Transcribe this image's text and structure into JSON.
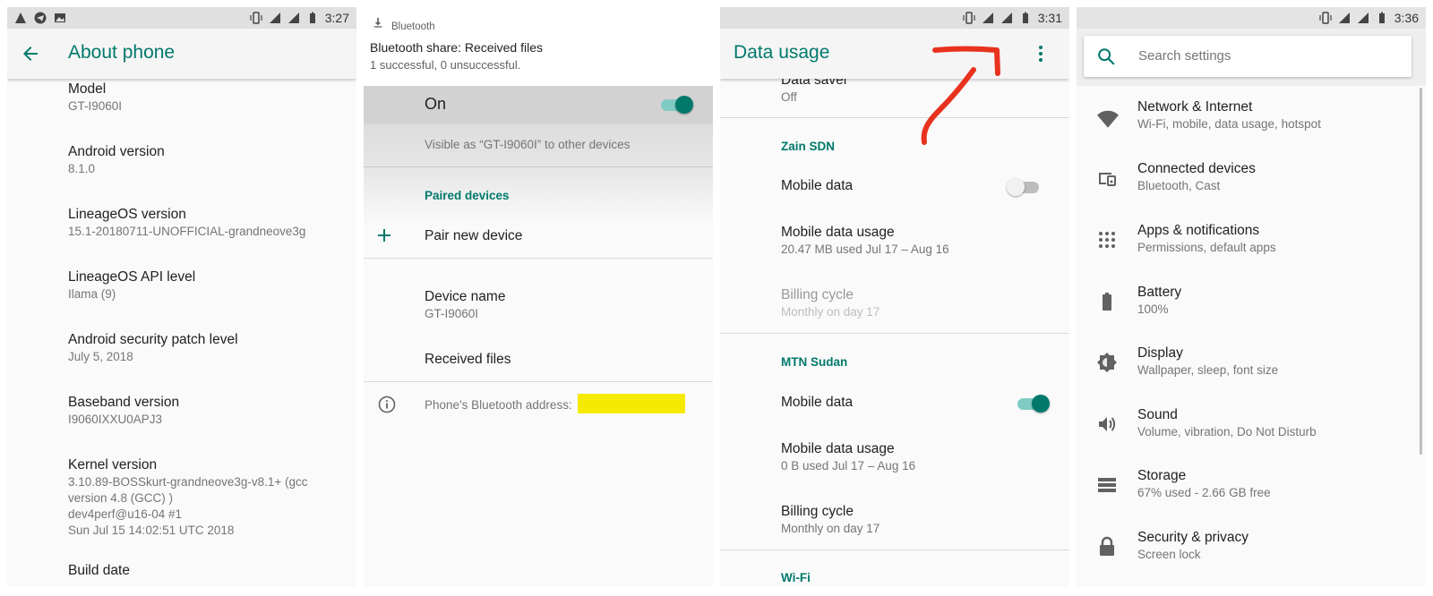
{
  "about_phone": {
    "status_time": "3:27",
    "title": "About phone",
    "items": [
      {
        "label": "Model",
        "value": "GT-I9060I"
      },
      {
        "label": "Android version",
        "value": "8.1.0"
      },
      {
        "label": "LineageOS version",
        "value": "15.1-20180711-UNOFFICIAL-grandneove3g"
      },
      {
        "label": "LineageOS API level",
        "value": "Ilama (9)"
      },
      {
        "label": "Android security patch level",
        "value": "July 5, 2018"
      },
      {
        "label": "Baseband version",
        "value": "I9060IXXU0APJ3"
      },
      {
        "label": "Kernel version",
        "value_lines": [
          "3.10.89-BOSSkurt-grandneove3g-v8.1+ (gcc",
          "version 4.8 (GCC) )",
          "dev4perf@u16-04 #1",
          "Sun Jul 15 14:02:51 UTC 2018"
        ]
      },
      {
        "label": "Build date"
      }
    ]
  },
  "bluetooth": {
    "notification": {
      "app": "Bluetooth",
      "title": "Bluetooth share: Received files",
      "text": "1 successful, 0 unsuccessful."
    },
    "on_label": "On",
    "visible_text": "Visible as “GT-I9060I” to other devices",
    "paired_header": "Paired devices",
    "pair_new": "Pair new device",
    "device_name_label": "Device name",
    "device_name_value": "GT-I9060I",
    "received_files": "Received files",
    "address_label": "Phone's Bluetooth address:",
    "highlight_color": "#f5ea00"
  },
  "data_usage": {
    "status_time": "3:31",
    "title": "Data usage",
    "data_saver_label": "Data saver",
    "data_saver_value": "Off",
    "sim1": {
      "name": "Zain SDN",
      "mobile_data": "Mobile data",
      "usage_label": "Mobile data usage",
      "usage_value": "20.47 MB used Jul 17 – Aug 16",
      "billing_label": "Billing cycle",
      "billing_value": "Monthly on day 17"
    },
    "sim2": {
      "name": "MTN Sudan",
      "mobile_data": "Mobile data",
      "usage_label": "Mobile data usage",
      "usage_value": "0 B used Jul 17 – Aug 16",
      "billing_label": "Billing cycle",
      "billing_value": "Monthly on day 17"
    },
    "cut_section": "Wi-Fi",
    "annotation_color": "#e8321e"
  },
  "settings": {
    "status_time": "3:36",
    "search_placeholder": "Search settings",
    "items": [
      {
        "icon": "wifi-icon",
        "title": "Network & Internet",
        "subtitle": "Wi-Fi, mobile, data usage, hotspot"
      },
      {
        "icon": "devices-icon",
        "title": "Connected devices",
        "subtitle": "Bluetooth, Cast"
      },
      {
        "icon": "apps-icon",
        "title": "Apps & notifications",
        "subtitle": "Permissions, default apps"
      },
      {
        "icon": "battery-icon",
        "title": "Battery",
        "subtitle": "100%"
      },
      {
        "icon": "brightness-icon",
        "title": "Display",
        "subtitle": "Wallpaper, sleep, font size"
      },
      {
        "icon": "volume-icon",
        "title": "Sound",
        "subtitle": "Volume, vibration, Do Not Disturb"
      },
      {
        "icon": "storage-icon",
        "title": "Storage",
        "subtitle": "67% used - 2.66 GB free"
      },
      {
        "icon": "lock-icon",
        "title": "Security & privacy",
        "subtitle": "Screen lock"
      }
    ]
  },
  "colors": {
    "accent": "#00796b",
    "accent_light": "#80cbc4"
  }
}
